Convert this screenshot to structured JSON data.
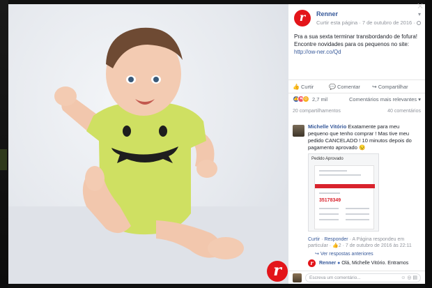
{
  "post": {
    "page_name": "Renner",
    "logo_letter": "r",
    "meta_prefix": "Curtir esta página",
    "date": "7 de outubro de 2016",
    "text_line1": "Pra a sua sexta terminar transbordando de fofura!",
    "text_line2": "Encontre novidades para os pequenos no site:",
    "link": "http://ow-ner.co/Qd"
  },
  "actions": {
    "like": "Curtir",
    "comment": "Comentar",
    "share": "Compartilhar"
  },
  "reactions": {
    "count": "2,7 mil",
    "sort_label": "Comentários mais relevantes"
  },
  "counts": {
    "shares": "20 compartilhamentos",
    "comments": "40 comentários"
  },
  "comment": {
    "author": "Michelle Vitório",
    "text": "Exatamente para meu pequeno que tenho comprar ! Mas tive meu pedido CANCELADO ! 10 minutos depois do pagamento aprovado 😒",
    "attachment_title": "Pedido Aprovado",
    "attachment_number": "35178349",
    "like_label": "Curtir",
    "reply_label": "Responder",
    "footer_tail": "· A Página respondeu em particular ·",
    "reply_count": "2",
    "footer_time": "· 7 de outubro de 2016 às 22:11"
  },
  "more_replies": "Ver respostas anteriores",
  "reply": {
    "author": "Renner",
    "text": "Olá, Michelle Vitório. Entramos"
  },
  "composer": {
    "placeholder": "Escreva um comentário..."
  },
  "colors": {
    "brand_red": "#e3151a",
    "link_blue": "#365899",
    "onesie_green": "#cfe062"
  }
}
